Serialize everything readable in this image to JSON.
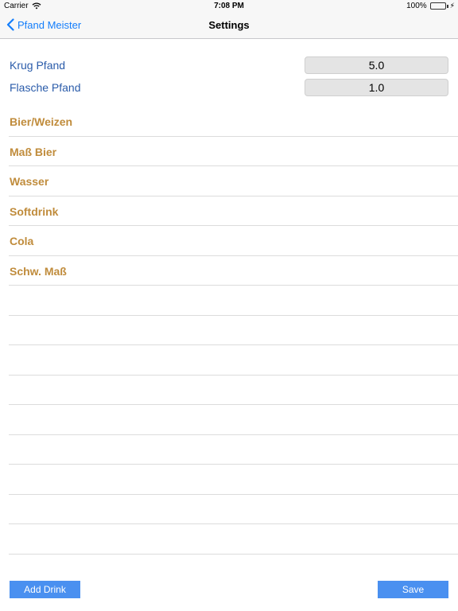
{
  "status_bar": {
    "carrier": "Carrier",
    "time": "7:08 PM",
    "battery": "100%",
    "battery_level": 1.0
  },
  "nav": {
    "back_label": "Pfand Meister",
    "title": "Settings"
  },
  "pfand": [
    {
      "label": "Krug Pfand",
      "value": "5.0"
    },
    {
      "label": "Flasche Pfand",
      "value": "1.0"
    }
  ],
  "drinks": [
    {
      "label": "Bier/Weizen"
    },
    {
      "label": "Maß Bier"
    },
    {
      "label": "Wasser"
    },
    {
      "label": "Softdrink"
    },
    {
      "label": "Cola"
    },
    {
      "label": "Schw. Maß"
    },
    {
      "label": ""
    },
    {
      "label": ""
    },
    {
      "label": ""
    },
    {
      "label": ""
    },
    {
      "label": ""
    },
    {
      "label": ""
    },
    {
      "label": ""
    },
    {
      "label": ""
    },
    {
      "label": ""
    }
  ],
  "buttons": {
    "add_label": "Add Drink",
    "save_label": "Save"
  },
  "colors": {
    "accent": "#147efb",
    "pfand_label": "#2b5caa",
    "drink_label": "#c08c3c",
    "button_bg": "#4a90f0",
    "battery": "#4cd964"
  },
  "icons": {
    "wifi": "wifi-icon",
    "back": "chevron-left-icon",
    "battery": "battery-icon",
    "charging": "charging-bolt-icon"
  }
}
